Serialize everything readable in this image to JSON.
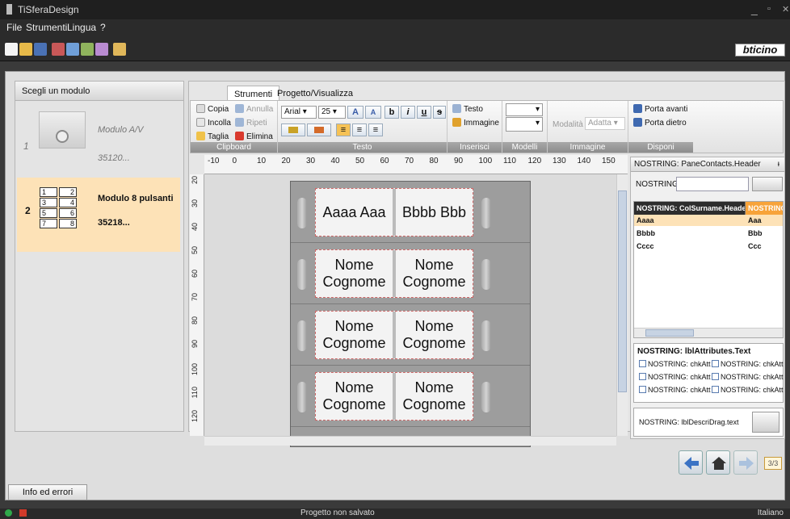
{
  "window": {
    "title": "TiSferaDesign"
  },
  "menu": [
    "File",
    "Strumenti",
    "Lingua",
    "?"
  ],
  "brand": {
    "logo": "bticino"
  },
  "left_panel": {
    "title": "Scegli un modulo",
    "modules": [
      {
        "index": "1",
        "name": "Modulo A/V",
        "code": "35120..."
      },
      {
        "index": "2",
        "name": "Modulo 8 pulsanti",
        "code": "35218...",
        "buttons": [
          "1",
          "2",
          "3",
          "4",
          "5",
          "6",
          "7",
          "8"
        ]
      }
    ]
  },
  "ribbon": {
    "tabs": [
      "Strumenti",
      "Progetto/Visualizza"
    ],
    "active_tab": "Strumenti",
    "clipboard": {
      "label": "Clipboard",
      "copy": "Copia",
      "paste": "Incolla",
      "cut": "Taglia",
      "undo": "Annulla",
      "redo": "Ripeti",
      "delete": "Elimina"
    },
    "text": {
      "label": "Testo",
      "font": "Arial",
      "size": "25",
      "grow": "A",
      "shrink": "A",
      "bold": "b",
      "italic": "i",
      "underline": "u",
      "strike": "s"
    },
    "insert": {
      "label": "Inserisci",
      "text": "Testo",
      "image": "Immagine"
    },
    "models": {
      "label": "Modelli"
    },
    "image": {
      "label": "Immagine",
      "mode_label": "Modalità",
      "mode_value": "Adatta"
    },
    "arrange": {
      "label": "Disponi",
      "forward": "Porta avanti",
      "back": "Porta dietro"
    }
  },
  "ruler": {
    "h": [
      "-10",
      "0",
      "10",
      "20",
      "30",
      "40",
      "50",
      "60",
      "70",
      "80",
      "90",
      "100",
      "110",
      "120",
      "130",
      "140",
      "150"
    ],
    "v": [
      "20",
      "30",
      "40",
      "50",
      "60",
      "70",
      "80",
      "90",
      "100",
      "110",
      "120"
    ]
  },
  "panel": {
    "rows": [
      {
        "left": "Aaaa Aaa",
        "right": "Bbbb Bbb"
      },
      {
        "left": "Nome Cognome",
        "right": "Nome Cognome"
      },
      {
        "left": "Nome Cognome",
        "right": "Nome Cognome"
      },
      {
        "left": "Nome Cognome",
        "right": "Nome Cognome"
      }
    ]
  },
  "contacts": {
    "header": "NOSTRING: PaneContacts.Header",
    "search_label": "NOSTRING:",
    "col_surname": "NOSTRING: ColSurname.Header",
    "col_name": "NOSTRING: ",
    "rows": [
      [
        "Aaaa",
        "Aaa"
      ],
      [
        "Bbbb",
        "Bbb"
      ],
      [
        "Cccc",
        "Ccc"
      ]
    ],
    "attributes_title": "NOSTRING: lblAttributes.Text",
    "checkboxes": [
      "NOSTRING: chkAtt",
      "NOSTRING: chkAtt",
      "NOSTRING: chkAtt",
      "NOSTRING: chkAtt",
      "NOSTRING: chkAtt",
      "NOSTRING: chkAtt"
    ],
    "drag_label": "NOSTRING: lblDescriDrag.text"
  },
  "pager": "3/3",
  "info_button": "Info ed errori",
  "status": {
    "message": "Progetto non salvato",
    "language": "Italiano"
  },
  "colors": {
    "accent": "#f7a33a",
    "selection": "#fde2b7",
    "grid_header": "#2d2d2d"
  }
}
